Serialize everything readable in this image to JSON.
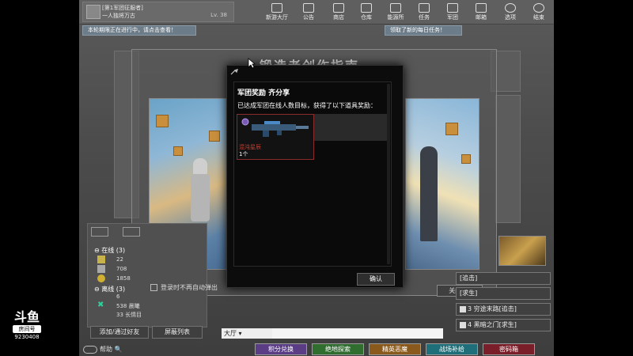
{
  "profile": {
    "line1": "[第1军团征服者]",
    "line2": "一人独将万古",
    "level": "Lv. 38"
  },
  "nav": [
    {
      "label": "新游大厅",
      "icon": "hall-icon"
    },
    {
      "label": "公告",
      "icon": "speaker-icon"
    },
    {
      "label": "商店",
      "icon": "shop-icon"
    },
    {
      "label": "仓库",
      "icon": "storage-icon"
    },
    {
      "label": "能源所",
      "icon": "energy-icon"
    },
    {
      "label": "任务",
      "icon": "task-icon"
    },
    {
      "label": "军团",
      "icon": "legion-icon"
    },
    {
      "label": "邮箱",
      "icon": "mail-icon"
    },
    {
      "label": "选项",
      "icon": "gear-icon"
    },
    {
      "label": "结束",
      "icon": "power-icon"
    }
  ],
  "notices": {
    "left": "本轮期限正在进行中，请点击查看！",
    "right": "领取了新的每日任务！"
  },
  "background_title": "锻造者创作指南",
  "friends": {
    "online_label": "在线 (3)",
    "online_values": [
      "22",
      "708",
      "1858"
    ],
    "offline_label": "离线 (3)",
    "offline_values": [
      "6",
      "538  晨曦",
      "33  长情目"
    ],
    "add_button": "添加/通过好友",
    "block_button": "屏蔽列表"
  },
  "checkbox_label": "登录时不再自动弹出",
  "close_button": "关闭 (f)",
  "right_list": [
    {
      "label": "[追击]"
    },
    {
      "label": "[求生]"
    },
    {
      "label": "3 穷途末路[追击]"
    },
    {
      "label": "4 黑暗之门[求生]"
    }
  ],
  "chat": {
    "channel": "大厅"
  },
  "bottom_buttons": [
    {
      "label": "积分兑换",
      "color": "#5b3d86"
    },
    {
      "label": "绝地探索",
      "color": "#2f6e2f"
    },
    {
      "label": "精英恶魔",
      "color": "#8a5a1c"
    },
    {
      "label": "战场补给",
      "color": "#1f6f7a"
    },
    {
      "label": "密码箱",
      "color": "#7a1f2a"
    }
  ],
  "help_label": "帮助",
  "modal": {
    "title": "军团奖励  齐分享",
    "desc": "已达成军团在线人数目标，获得了以下道具奖励：",
    "item_name": "混沌星辰",
    "item_count": "1个",
    "ok_button": "确认"
  },
  "stream": {
    "logo": "斗鱼",
    "room_label": "房间号",
    "room_id": "9230408"
  }
}
